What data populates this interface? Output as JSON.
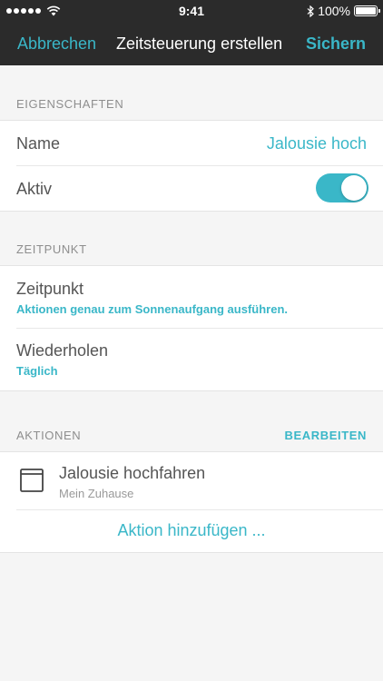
{
  "status_bar": {
    "time": "9:41",
    "battery": "100%",
    "signal_icon": "signal-dots-icon",
    "wifi_icon": "wifi-icon",
    "bluetooth_icon": "bluetooth-icon",
    "battery_icon": "battery-icon",
    "battery_level": 1.0
  },
  "nav": {
    "cancel_label": "Abbrechen",
    "title": "Zeitsteuerung erstellen",
    "save_label": "Sichern"
  },
  "properties": {
    "header": "EIGENSCHAFTEN",
    "name_label": "Name",
    "name_value": "Jalousie hoch",
    "active_label": "Aktiv",
    "active_on": true
  },
  "time": {
    "header": "ZEITPUNKT",
    "time_label": "Zeitpunkt",
    "time_value": "Aktionen genau zum Sonnenaufgang ausführen.",
    "repeat_label": "Wiederholen",
    "repeat_value": "Täglich"
  },
  "actions": {
    "header": "AKTIONEN",
    "edit_label": "BEARBEITEN",
    "items": [
      {
        "title": "Jalousie hochfahren",
        "subtitle": "Mein Zuhause",
        "icon": "blind-icon"
      }
    ],
    "add_label": "Aktion hinzufügen ..."
  },
  "colors": {
    "accent": "#3ab7c8",
    "nav_background": "#2b2b2b",
    "page_background": "#f5f5f5"
  }
}
